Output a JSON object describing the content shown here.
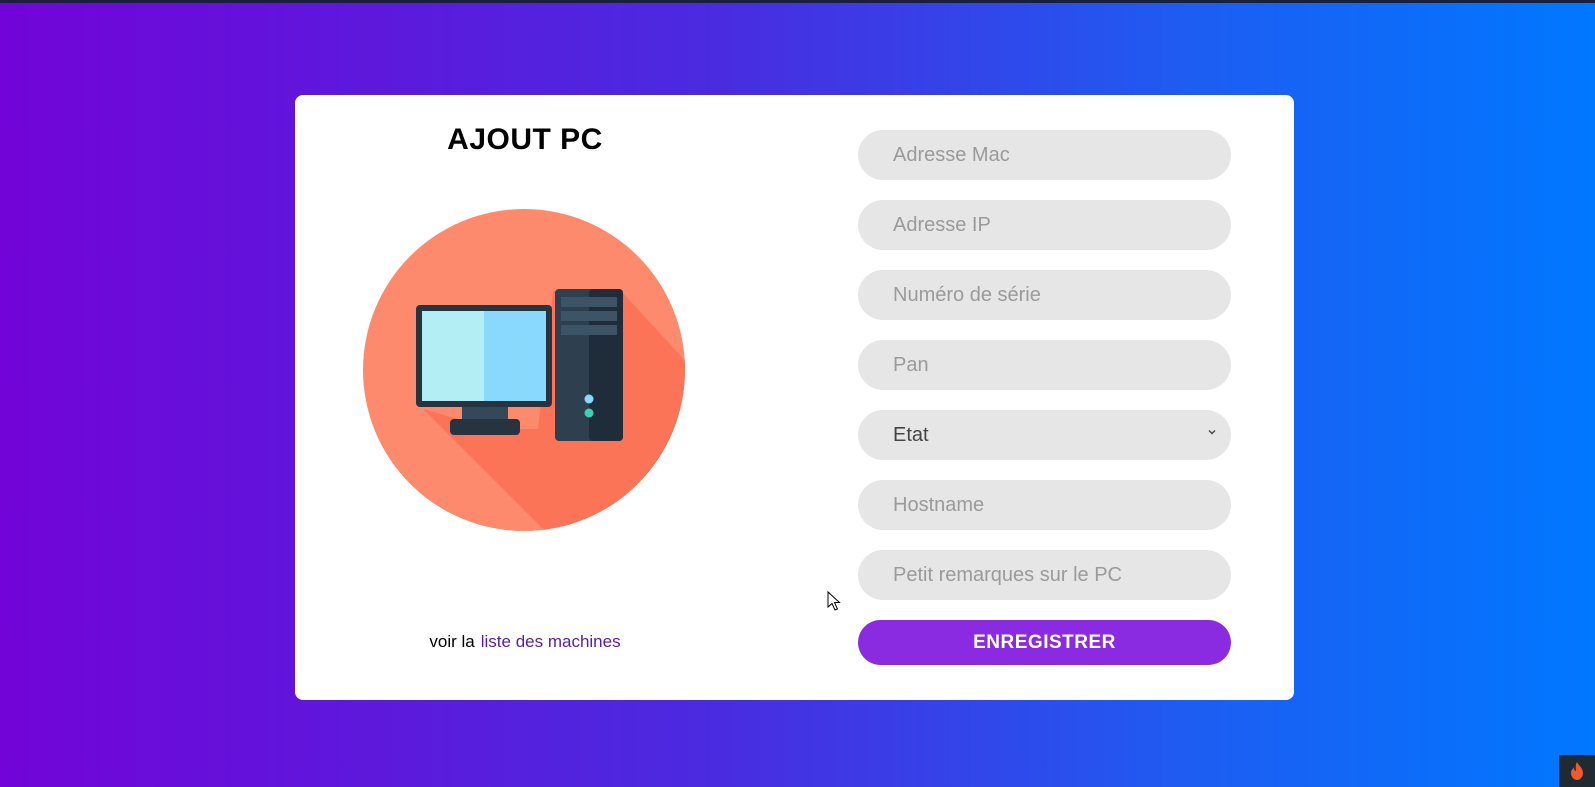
{
  "page": {
    "title": "AJOUT PC"
  },
  "illustration": {
    "icon": "desktop-computer-icon",
    "circle_color": "#fe8a6d",
    "shadow_color": "#fc7458"
  },
  "form": {
    "mac_placeholder": "Adresse Mac",
    "ip_placeholder": "Adresse IP",
    "serial_placeholder": "Numéro de série",
    "pan_placeholder": "Pan",
    "etat_selected": "Etat",
    "hostname_placeholder": "Hostname",
    "remarks_placeholder": "Petit remarques sur le PC",
    "submit_label": "ENREGISTRER"
  },
  "footer": {
    "prefix": "voir la",
    "link_text": "liste des machines"
  },
  "colors": {
    "accent": "#8a2be2",
    "link": "#5a1da6",
    "gradient_start": "#7204d8",
    "gradient_end": "#0078ff",
    "field_bg": "#e6e6e6"
  }
}
